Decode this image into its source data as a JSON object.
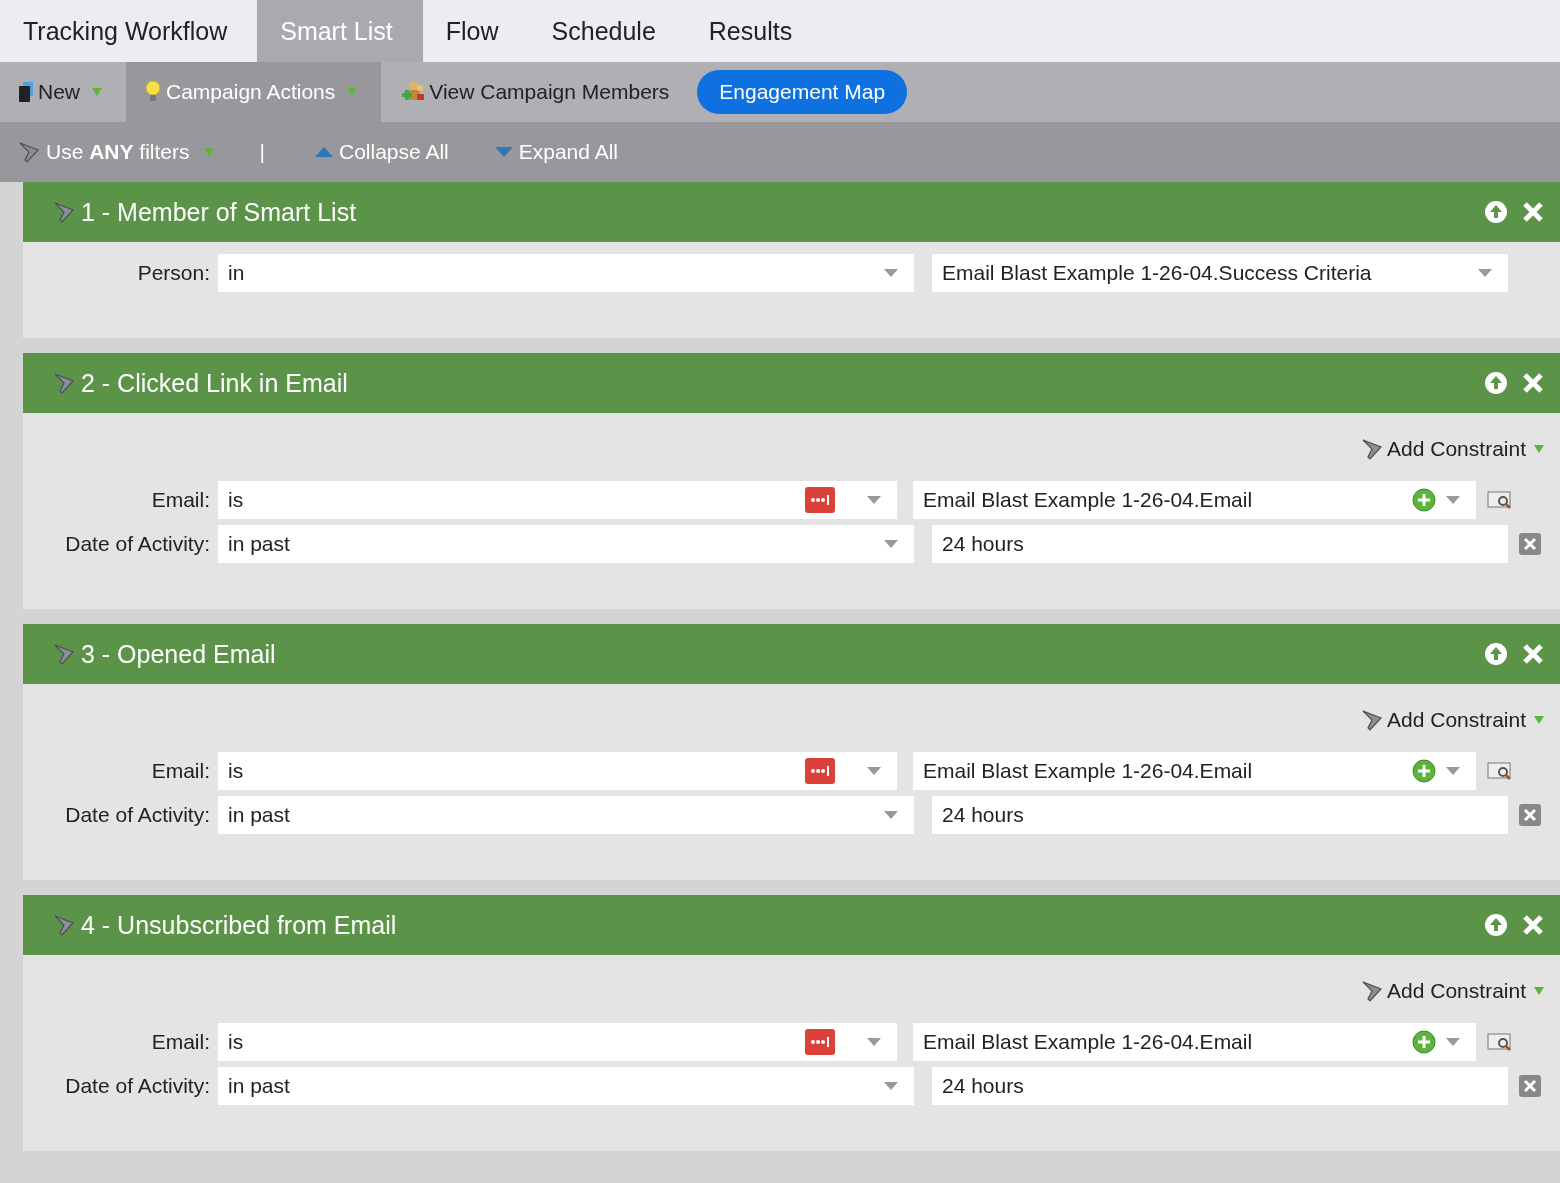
{
  "tabs": [
    {
      "label": "Tracking Workflow",
      "selected": false
    },
    {
      "label": "Smart List",
      "selected": true
    },
    {
      "label": "Flow",
      "selected": false
    },
    {
      "label": "Schedule",
      "selected": false
    },
    {
      "label": "Results",
      "selected": false
    }
  ],
  "toolbar": [
    {
      "label": "New",
      "kind": "menu",
      "selected": false
    },
    {
      "label": "Campaign Actions",
      "kind": "menu",
      "selected": true
    },
    {
      "label": "View Campaign Members",
      "kind": "button",
      "selected": false
    },
    {
      "label": "Engagement Map",
      "kind": "primary",
      "selected": false
    }
  ],
  "filter_bar": {
    "logic": "Use **ANY** filters",
    "separator": "|",
    "collapse": "Collapse All",
    "expand": "Expand All"
  },
  "filters": [
    {
      "title": "1 - Member of Smart List",
      "rows": [
        {
          "kind": "list",
          "label": "Person:",
          "operator": "in",
          "value": "Email Blast Example 1-26-04.Success Criteria"
        }
      ]
    },
    {
      "title": "2 - Clicked Link in Email",
      "add_constraint": "Add Constraint",
      "rows": [
        {
          "kind": "email",
          "label": "Email:",
          "operator": "is",
          "value": "Email Blast Example 1-26-04.Email"
        },
        {
          "kind": "date",
          "label": "Date of Activity:",
          "operator": "in past",
          "value": "24 hours"
        }
      ]
    },
    {
      "title": "3 - Opened Email",
      "add_constraint": "Add Constraint",
      "rows": [
        {
          "kind": "email",
          "label": "Email:",
          "operator": "is",
          "value": "Email Blast Example 1-26-04.Email"
        },
        {
          "kind": "date",
          "label": "Date of Activity:",
          "operator": "in past",
          "value": "24 hours"
        }
      ]
    },
    {
      "title": "4 - Unsubscribed from Email",
      "add_constraint": "Add Constraint",
      "rows": [
        {
          "kind": "email",
          "label": "Email:",
          "operator": "is",
          "value": "Email Blast Example 1-26-04.Email"
        },
        {
          "kind": "date",
          "label": "Date of Activity:",
          "operator": "in past",
          "value": "24 hours"
        }
      ]
    }
  ]
}
